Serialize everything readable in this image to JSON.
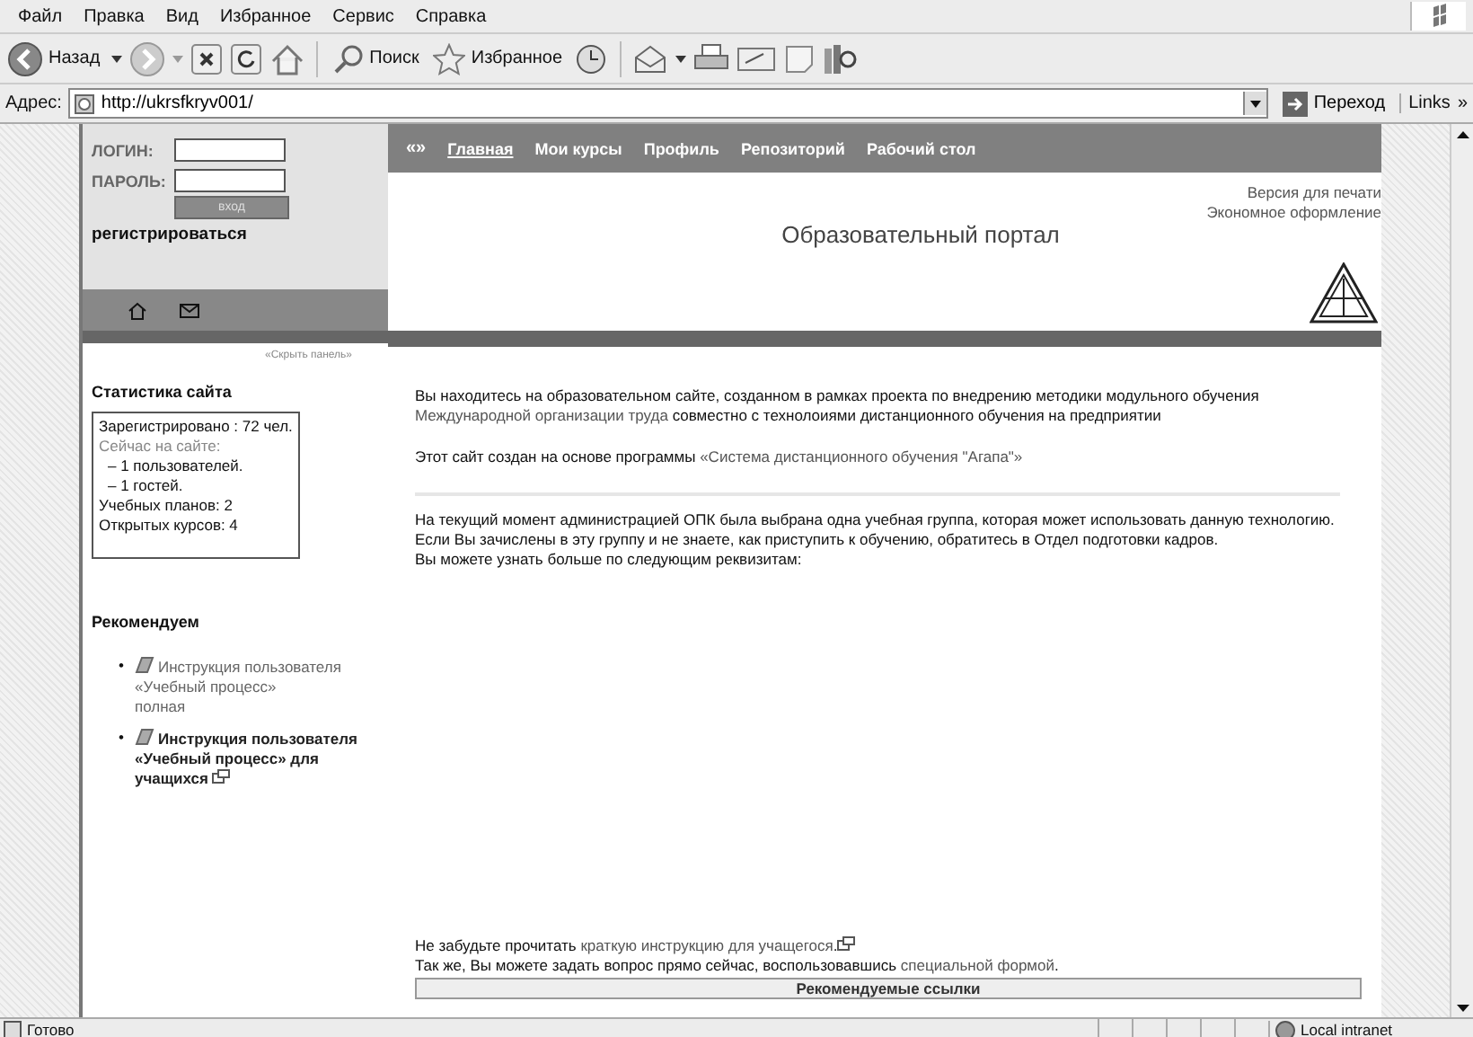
{
  "menu": [
    "Файл",
    "Правка",
    "Вид",
    "Избранное",
    "Сервис",
    "Справка"
  ],
  "toolbar": {
    "back": "Назад",
    "search": "Поиск",
    "favorites": "Избранное"
  },
  "address": {
    "label": "Адрес:",
    "url": "http://ukrsfkryv001/",
    "go": "Переход",
    "links": "Links",
    "more": "»"
  },
  "login": {
    "login_label": "ЛОГИН:",
    "password_label": "ПАРОЛЬ:",
    "submit": "вход",
    "register": "регистрироваться",
    "hide_panel": "«Скрыть панель»"
  },
  "nav": {
    "collapse": "«»",
    "items": [
      {
        "label": "Главная",
        "selected": true
      },
      {
        "label": "Мои курсы",
        "selected": false
      },
      {
        "label": "Профиль",
        "selected": false
      },
      {
        "label": "Репозиторий",
        "selected": false
      },
      {
        "label": "Рабочий стол",
        "selected": false
      }
    ]
  },
  "header": {
    "print_version": "Версия для печати",
    "economy": "Экономное оформление",
    "title": "Образовательный портал"
  },
  "stats": {
    "title": "Статистика сайта",
    "lines": [
      {
        "text": "Зарегистрировано : 72 чел.",
        "kind": "plain"
      },
      {
        "text": "Сейчас на сайте:",
        "kind": "muted"
      },
      {
        "text": "– 1 пользователей.",
        "kind": "indent"
      },
      {
        "text": "– 1 гостей.",
        "kind": "indent"
      },
      {
        "text": "Учебных планов: 2",
        "kind": "plain"
      },
      {
        "text": "Открытых курсов: 4",
        "kind": "plain"
      }
    ]
  },
  "recommended": {
    "title": "Рекомендуем",
    "items": [
      {
        "marker": "•",
        "title": "Инструкция пользователя «Учебный процесс»",
        "note": "полная",
        "bold": false,
        "popup": false
      },
      {
        "marker": "•",
        "title": "Инструкция пользователя «Учебный процесс» для учащихся",
        "bold": true,
        "popup": true
      }
    ]
  },
  "paragraphs": [
    {
      "parts": [
        {
          "text": "Вы находитесь на образовательном сайте, созданном в рамках проекта по внедрению методики модульного обучения ",
          "kind": "text"
        },
        {
          "text": "Международной организации труда",
          "kind": "link"
        },
        {
          "text": " совместно с технолоиями дистанционного обучения на предприятии",
          "kind": "text"
        }
      ]
    },
    {
      "parts": [
        {
          "text": "Этот сайт создан на основе программы ",
          "kind": "text"
        },
        {
          "text": "«Система дистанционного обучения \"Агапа\"»",
          "kind": "link"
        }
      ]
    },
    {
      "divider": true,
      "parts": [
        {
          "text": "На текущий момент администрацией ОПК была выбрана одна учебная группа, которая может использовать данную технологию. Если Вы зачислены в эту группу и не знаете, как приступить к обучению, обратитесь в Отдел подготовки кадров.",
          "kind": "text"
        }
      ]
    },
    {
      "parts": [
        {
          "text": "Вы можете узнать больше по следующим реквизитам:",
          "kind": "text"
        }
      ]
    }
  ],
  "footer_lines": [
    {
      "parts": [
        {
          "text": "Не забудьте прочитать ",
          "kind": "text"
        },
        {
          "text": "краткую инструкцию для учащегося",
          "kind": "link"
        },
        {
          "text": ".",
          "kind": "text"
        }
      ],
      "popup": true
    },
    {
      "parts": [
        {
          "text": "Так же, Вы можете задать вопрос прямо сейчас, воспользовавшись ",
          "kind": "text"
        },
        {
          "text": "специальной формой",
          "kind": "link"
        },
        {
          "text": ".",
          "kind": "text"
        }
      ],
      "popup": false
    }
  ],
  "links_header": "Рекомендуемые ссылки",
  "status": {
    "text": "Готово",
    "zone": "Local intranet"
  }
}
